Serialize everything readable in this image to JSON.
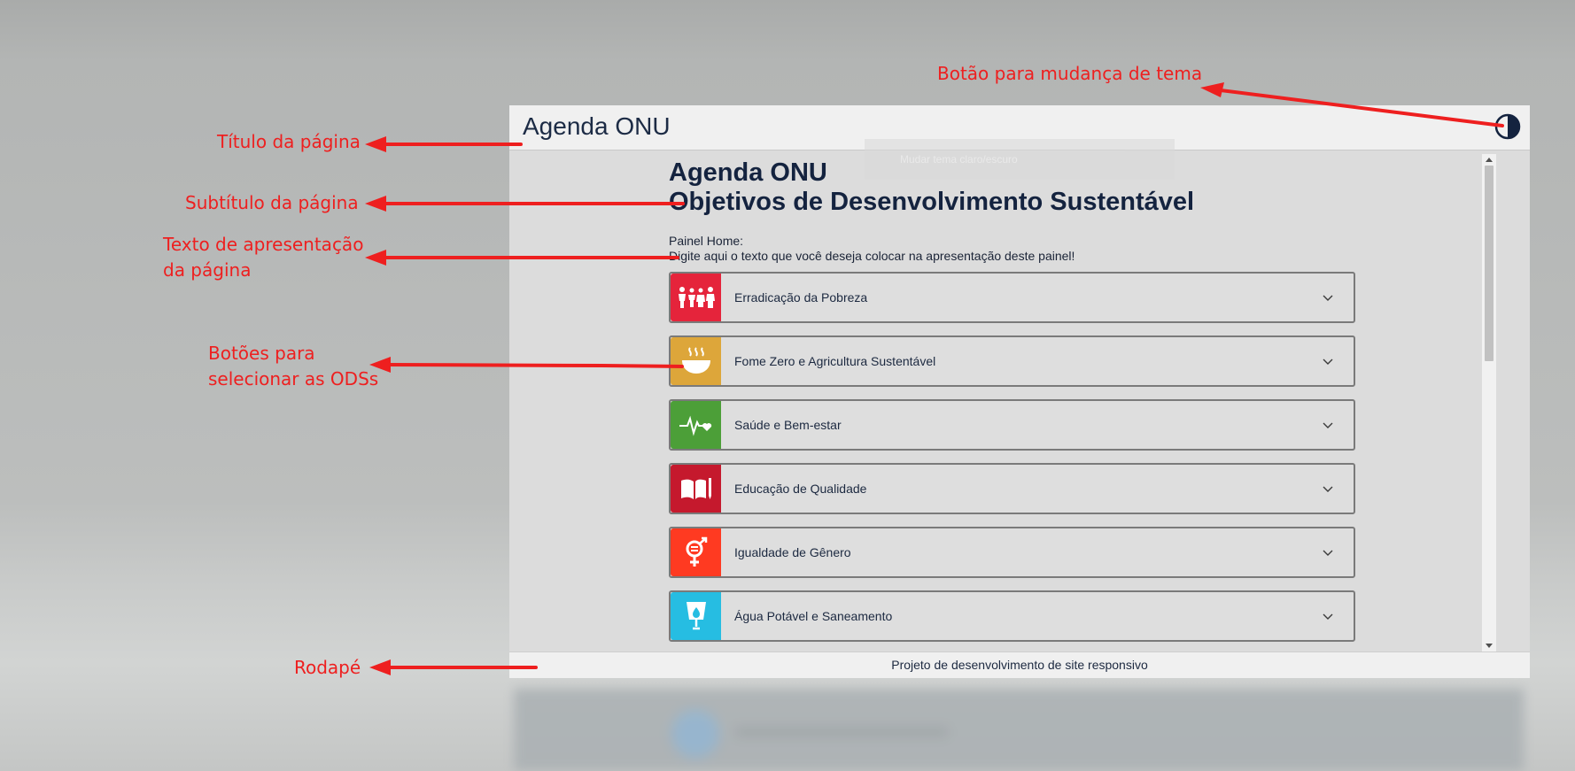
{
  "app": {
    "title": "Agenda ONU",
    "theme_icon": "half-circle-theme-icon",
    "tooltip_faint": "Mudar tema claro/escuro"
  },
  "main": {
    "title_line1": "Agenda ONU",
    "title_line2": "Objetivos de Desenvolvimento Sustentável",
    "intro_line1": "Painel Home:",
    "intro_line2": "Digite aqui o texto que você deseja colocar na apresentação deste painel!"
  },
  "ods_items": [
    {
      "label": "Erradicação da Pobreza",
      "color": "#e5243b",
      "icon": "family-icon"
    },
    {
      "label": "Fome Zero e Agricultura Sustentável",
      "color": "#dda63a",
      "icon": "food-bowl-icon"
    },
    {
      "label": "Saúde e Bem-estar",
      "color": "#4c9f38",
      "icon": "heartbeat-icon"
    },
    {
      "label": "Educação de Qualidade",
      "color": "#c5192d",
      "icon": "book-pencil-icon"
    },
    {
      "label": "Igualdade de Gênero",
      "color": "#ff3a21",
      "icon": "gender-equality-icon"
    },
    {
      "label": "Água Potável e Saneamento",
      "color": "#26bde2",
      "icon": "water-drop-icon"
    }
  ],
  "footer": {
    "text": "Projeto de desenvolvimento de site responsivo"
  },
  "annotations": {
    "theme_button": "Botão para mudança de tema",
    "page_title": "Título da página",
    "page_subtitle": "Subtítulo da página",
    "intro_text": "Texto de apresentação\nda página",
    "ods_buttons": "Botões para\nselecionar as ODSs",
    "footer": "Rodapé",
    "color": "#ee1f1f"
  }
}
